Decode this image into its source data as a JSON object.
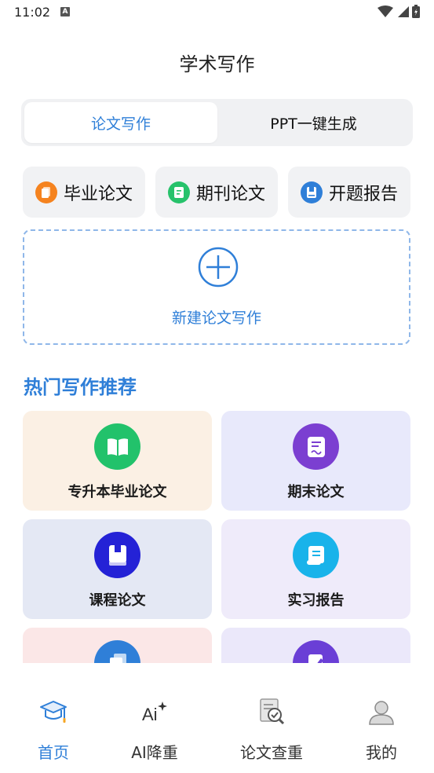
{
  "status_bar": {
    "time": "11:02",
    "notification_glyph": "A"
  },
  "header": {
    "title": "学术写作"
  },
  "mode_tabs": [
    {
      "label": "论文写作",
      "active": true
    },
    {
      "label": "PPT一键生成",
      "active": false
    }
  ],
  "quick_actions": [
    {
      "label": "毕业论文",
      "icon": "document-icon",
      "color": "#f5831f"
    },
    {
      "label": "期刊论文",
      "icon": "journal-icon",
      "color": "#27c26b"
    },
    {
      "label": "开题报告",
      "icon": "report-icon",
      "color": "#2f7fd8"
    }
  ],
  "new_writing": {
    "label": "新建论文写作",
    "icon": "plus-circle-icon"
  },
  "hot_section": {
    "title": "热门写作推荐"
  },
  "recommendations": [
    {
      "label": "专升本毕业论文",
      "icon": "open-book-icon",
      "icon_color": "#22c26b",
      "bg": "#fbf0e4"
    },
    {
      "label": "期末论文",
      "icon": "exam-paper-icon",
      "icon_color": "#7b3fd1",
      "bg": "#e8e9fb"
    },
    {
      "label": "课程论文",
      "icon": "book-icon",
      "icon_color": "#2422d6",
      "bg": "#e4e8f4"
    },
    {
      "label": "实习报告",
      "icon": "scroll-icon",
      "icon_color": "#19b3ea",
      "bg": "#efebfa"
    },
    {
      "label": "",
      "icon": "files-icon",
      "icon_color": "#2f7fd8",
      "bg": "#fbe7e7"
    },
    {
      "label": "",
      "icon": "notebook-pen-icon",
      "icon_color": "#6a3fd6",
      "bg": "#ebe8fa"
    }
  ],
  "tabbar": [
    {
      "label": "首页",
      "icon": "graduation-cap-icon",
      "active": true
    },
    {
      "label": "AI降重",
      "icon": "ai-sparkle-icon",
      "active": false
    },
    {
      "label": "论文查重",
      "icon": "document-check-icon",
      "active": false
    },
    {
      "label": "我的",
      "icon": "user-avatar-icon",
      "active": false
    }
  ],
  "colors": {
    "accent": "#2f7fd8",
    "page_bg": "#ffffff",
    "chip_bg": "#f1f2f4"
  }
}
